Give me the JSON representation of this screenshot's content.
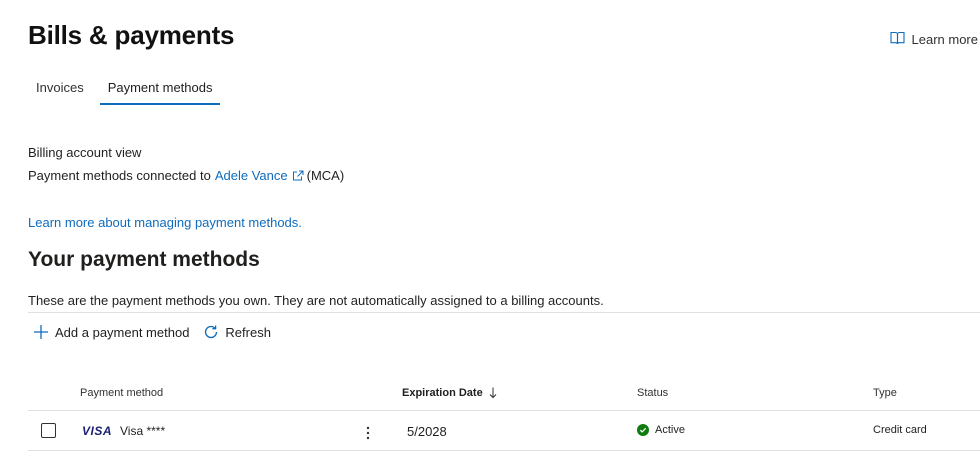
{
  "page": {
    "title": "Bills & payments",
    "learn_more": "Learn more"
  },
  "tabs": [
    {
      "label": "Invoices",
      "active": false
    },
    {
      "label": "Payment methods",
      "active": true
    }
  ],
  "billing": {
    "label": "Billing account view",
    "connected_prefix": "Payment methods connected to",
    "account_name": "Adele Vance",
    "account_suffix": "(MCA)"
  },
  "manage_link": "Learn more about managing payment methods.",
  "section": {
    "title": "Your payment methods",
    "description": "These are the payment methods you own. They are not automatically assigned to a billing accounts."
  },
  "toolbar": {
    "add_label": "Add a payment method",
    "refresh_label": "Refresh"
  },
  "table": {
    "headers": {
      "method": "Payment method",
      "expiration": "Expiration Date",
      "status": "Status",
      "type": "Type"
    },
    "rows": [
      {
        "brand_logo": "VISA",
        "method": "Visa ****",
        "expiration": "5/2028",
        "status": "Active",
        "type": "Credit card"
      }
    ]
  },
  "colors": {
    "accent": "#0f6cbd",
    "status_active": "#107c10",
    "visa": "#1a1f71"
  },
  "icons": [
    "book-icon",
    "external-link-icon",
    "plus-icon",
    "refresh-icon",
    "sort-down-icon",
    "more-vertical-icon",
    "check-circle-icon"
  ]
}
